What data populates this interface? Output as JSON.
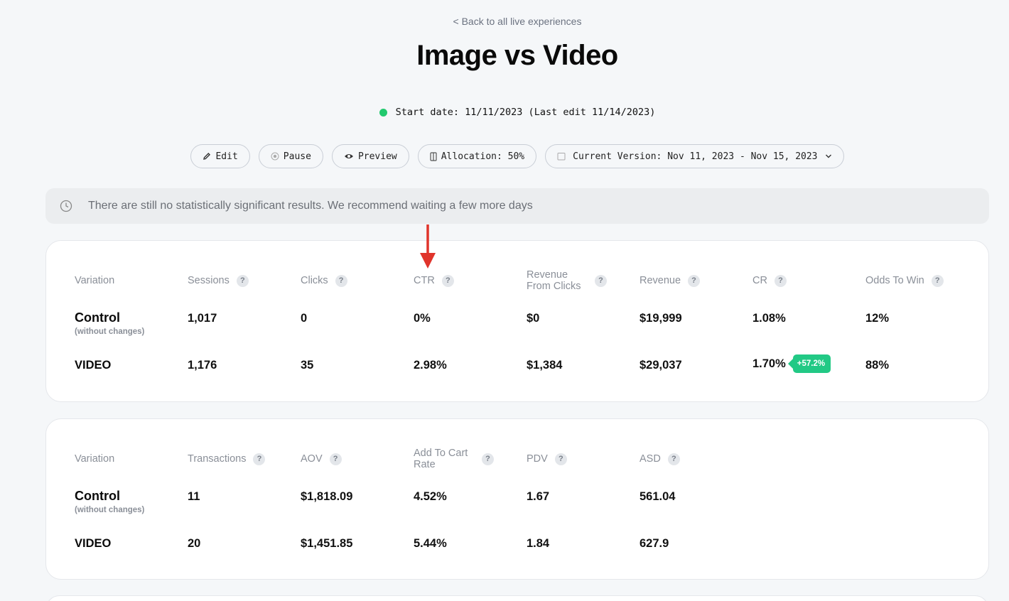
{
  "back_link": "< Back to all live experiences",
  "title": "Image vs Video",
  "start_info": "Start date: 11/11/2023 (Last edit 11/14/2023)",
  "toolbar": {
    "edit": "Edit",
    "pause": "Pause",
    "preview": "Preview",
    "allocation": "Allocation: 50%",
    "version": "Current Version: Nov 11, 2023 - Nov 15, 2023"
  },
  "alert": "There are still no statistically significant results. We recommend waiting a few more days",
  "colors": {
    "status_green": "#22c96e",
    "uplift_green": "#22c985",
    "annotation_red": "#e0342b"
  },
  "table1": {
    "headers": [
      "Variation",
      "Sessions",
      "Clicks",
      "CTR",
      "Revenue From Clicks",
      "Revenue",
      "CR",
      "Odds To Win"
    ],
    "rows": [
      {
        "name": "Control",
        "sub": "(without changes)",
        "values": [
          "1,017",
          "0",
          "0%",
          "$0",
          "$19,999",
          "1.08%",
          "12%"
        ]
      },
      {
        "name": "VIDEO",
        "sub": "",
        "values": [
          "1,176",
          "35",
          "2.98%",
          "$1,384",
          "$29,037",
          "1.70%",
          "88%"
        ],
        "uplift": "+57.2%"
      }
    ]
  },
  "table2": {
    "headers": [
      "Variation",
      "Transactions",
      "AOV",
      "Add To Cart Rate",
      "PDV",
      "ASD"
    ],
    "rows": [
      {
        "name": "Control",
        "sub": "(without changes)",
        "values": [
          "11",
          "$1,818.09",
          "4.52%",
          "1.67",
          "561.04"
        ]
      },
      {
        "name": "VIDEO",
        "sub": "",
        "values": [
          "20",
          "$1,451.85",
          "5.44%",
          "1.84",
          "627.9"
        ]
      }
    ]
  },
  "help_mark": "?"
}
